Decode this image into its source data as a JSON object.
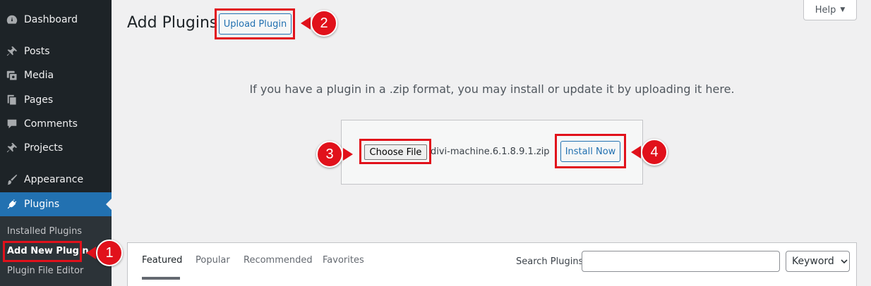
{
  "sidebar": {
    "items": [
      {
        "label": "Dashboard",
        "icon": "dashboard-icon"
      },
      {
        "label": "Posts",
        "icon": "pin-icon"
      },
      {
        "label": "Media",
        "icon": "media-icon"
      },
      {
        "label": "Pages",
        "icon": "pages-icon"
      },
      {
        "label": "Comments",
        "icon": "comment-icon"
      },
      {
        "label": "Projects",
        "icon": "pin-icon"
      },
      {
        "label": "Appearance",
        "icon": "brush-icon"
      },
      {
        "label": "Plugins",
        "icon": "plug-icon"
      }
    ],
    "submenu": [
      {
        "label": "Installed Plugins"
      },
      {
        "label": "Add New Plugin"
      },
      {
        "label": "Plugin File Editor"
      }
    ]
  },
  "header": {
    "title": "Add Plugins",
    "upload_button": "Upload Plugin",
    "help_button": "Help",
    "help_caret": "▼"
  },
  "upload": {
    "instructions": "If you have a plugin in a .zip format, you may install or update it by uploading it here.",
    "choose_file": "Choose File",
    "file_name": "divi-machine.6.1.8.9.1.zip",
    "install_button": "Install Now"
  },
  "filter": {
    "tabs": [
      {
        "label": "Featured"
      },
      {
        "label": "Popular"
      },
      {
        "label": "Recommended"
      },
      {
        "label": "Favorites"
      }
    ],
    "search_label": "Search Plugins",
    "search_value": "",
    "select_value": "Keyword"
  },
  "annotations": {
    "step1": "1",
    "step2": "2",
    "step3": "3",
    "step4": "4",
    "color": "#e1111b"
  }
}
